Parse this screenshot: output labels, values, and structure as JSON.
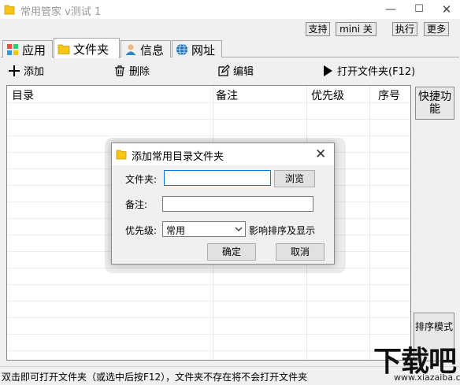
{
  "window": {
    "title": "常用管家 v测试 1",
    "min_glyph": "—",
    "max_glyph": "☐",
    "close_glyph": "✕"
  },
  "top_buttons": {
    "support": "支持",
    "mini": "mini 关",
    "execute": "执行",
    "more": "更多"
  },
  "tabs": [
    {
      "label": "应用",
      "icon": "apps-icon"
    },
    {
      "label": "文件夹",
      "icon": "folder-icon"
    },
    {
      "label": "信息",
      "icon": "user-info-icon"
    },
    {
      "label": "网址",
      "icon": "globe-icon"
    }
  ],
  "toolbar": {
    "add": "添加",
    "delete": "删除",
    "edit": "编辑",
    "open": "打开文件夹(F12)"
  },
  "list": {
    "columns": [
      "目录",
      "备注",
      "优先级",
      "序号"
    ]
  },
  "side_buttons": {
    "quick": "快捷功能",
    "sort": "排序模式"
  },
  "status": "双击即可打开文件夹（或选中后按F12），文件夹不存在将不会打开文件夹",
  "watermark": {
    "text": "下载吧",
    "url": "www.xiazaiba.com"
  },
  "dialog": {
    "title": "添加常用目录文件夹",
    "close_glyph": "✕",
    "folder_label": "文件夹:",
    "folder_value": "",
    "browse": "浏览",
    "note_label": "备注:",
    "note_value": "",
    "priority_label": "优先级:",
    "priority_value": "常用",
    "priority_hint": "影响排序及显示",
    "ok": "确定",
    "cancel": "取消"
  },
  "colors": {
    "folder_yellow": "#f5c518",
    "focus_blue": "#0078d7",
    "globe_blue": "#1e6fb8"
  }
}
